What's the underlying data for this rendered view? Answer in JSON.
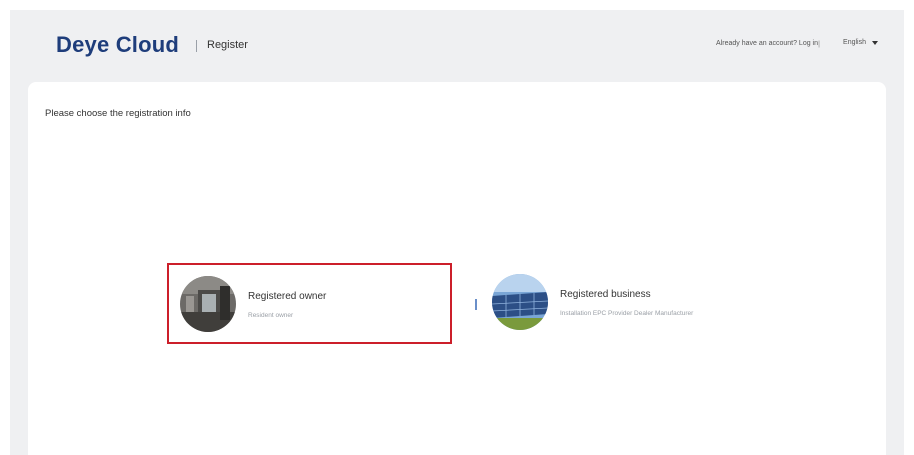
{
  "header": {
    "logo_text": "Deye Cloud",
    "page_title": "Register",
    "login_prompt": "Already have an account? Log in",
    "login_divider": "|",
    "language": "English"
  },
  "panel": {
    "heading": "Please choose the registration info"
  },
  "options": [
    {
      "title": "Registered owner",
      "subtitle": "Resident owner"
    },
    {
      "title": "Registered business",
      "subtitle": "Installation EPC Provider Dealer Manufacturer"
    }
  ],
  "colors": {
    "brand": "#1e3d7b",
    "selected_border": "#cc1f2a",
    "separator": "#6a8fc9",
    "background": "#eff0f2"
  },
  "icons": {
    "language_dropdown": "caret-down-icon",
    "owner_image": "house-interior-photo",
    "business_image": "solar-panels-photo"
  }
}
